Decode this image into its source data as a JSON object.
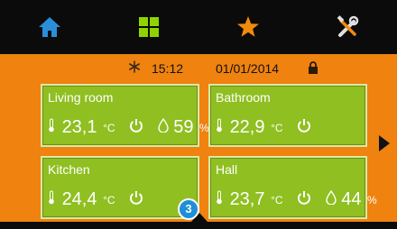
{
  "colors": {
    "background": "#f0820f",
    "topbar": "#0b0b0b",
    "card": "#8fbf21",
    "home_icon": "#2a8fd8",
    "grid_icon": "#8ed400",
    "star_icon": "#f28a0c",
    "badge": "#1e8fd8"
  },
  "topbar": {
    "icons": [
      "home-icon",
      "grid-icon",
      "star-icon",
      "tools-icon"
    ]
  },
  "status": {
    "time": "15:12",
    "date": "01/01/2014"
  },
  "rooms": [
    {
      "name": "Living room",
      "temp": "23,1",
      "unit": "°C",
      "humidity": "59",
      "humidity_unit": "%"
    },
    {
      "name": "Bathroom",
      "temp": "22,9",
      "unit": "°C"
    },
    {
      "name": "Kitchen",
      "temp": "24,4",
      "unit": "°C"
    },
    {
      "name": "Hall",
      "temp": "23,7",
      "unit": "°C",
      "humidity": "44",
      "humidity_unit": "%"
    }
  ],
  "badge": {
    "count": "3"
  }
}
